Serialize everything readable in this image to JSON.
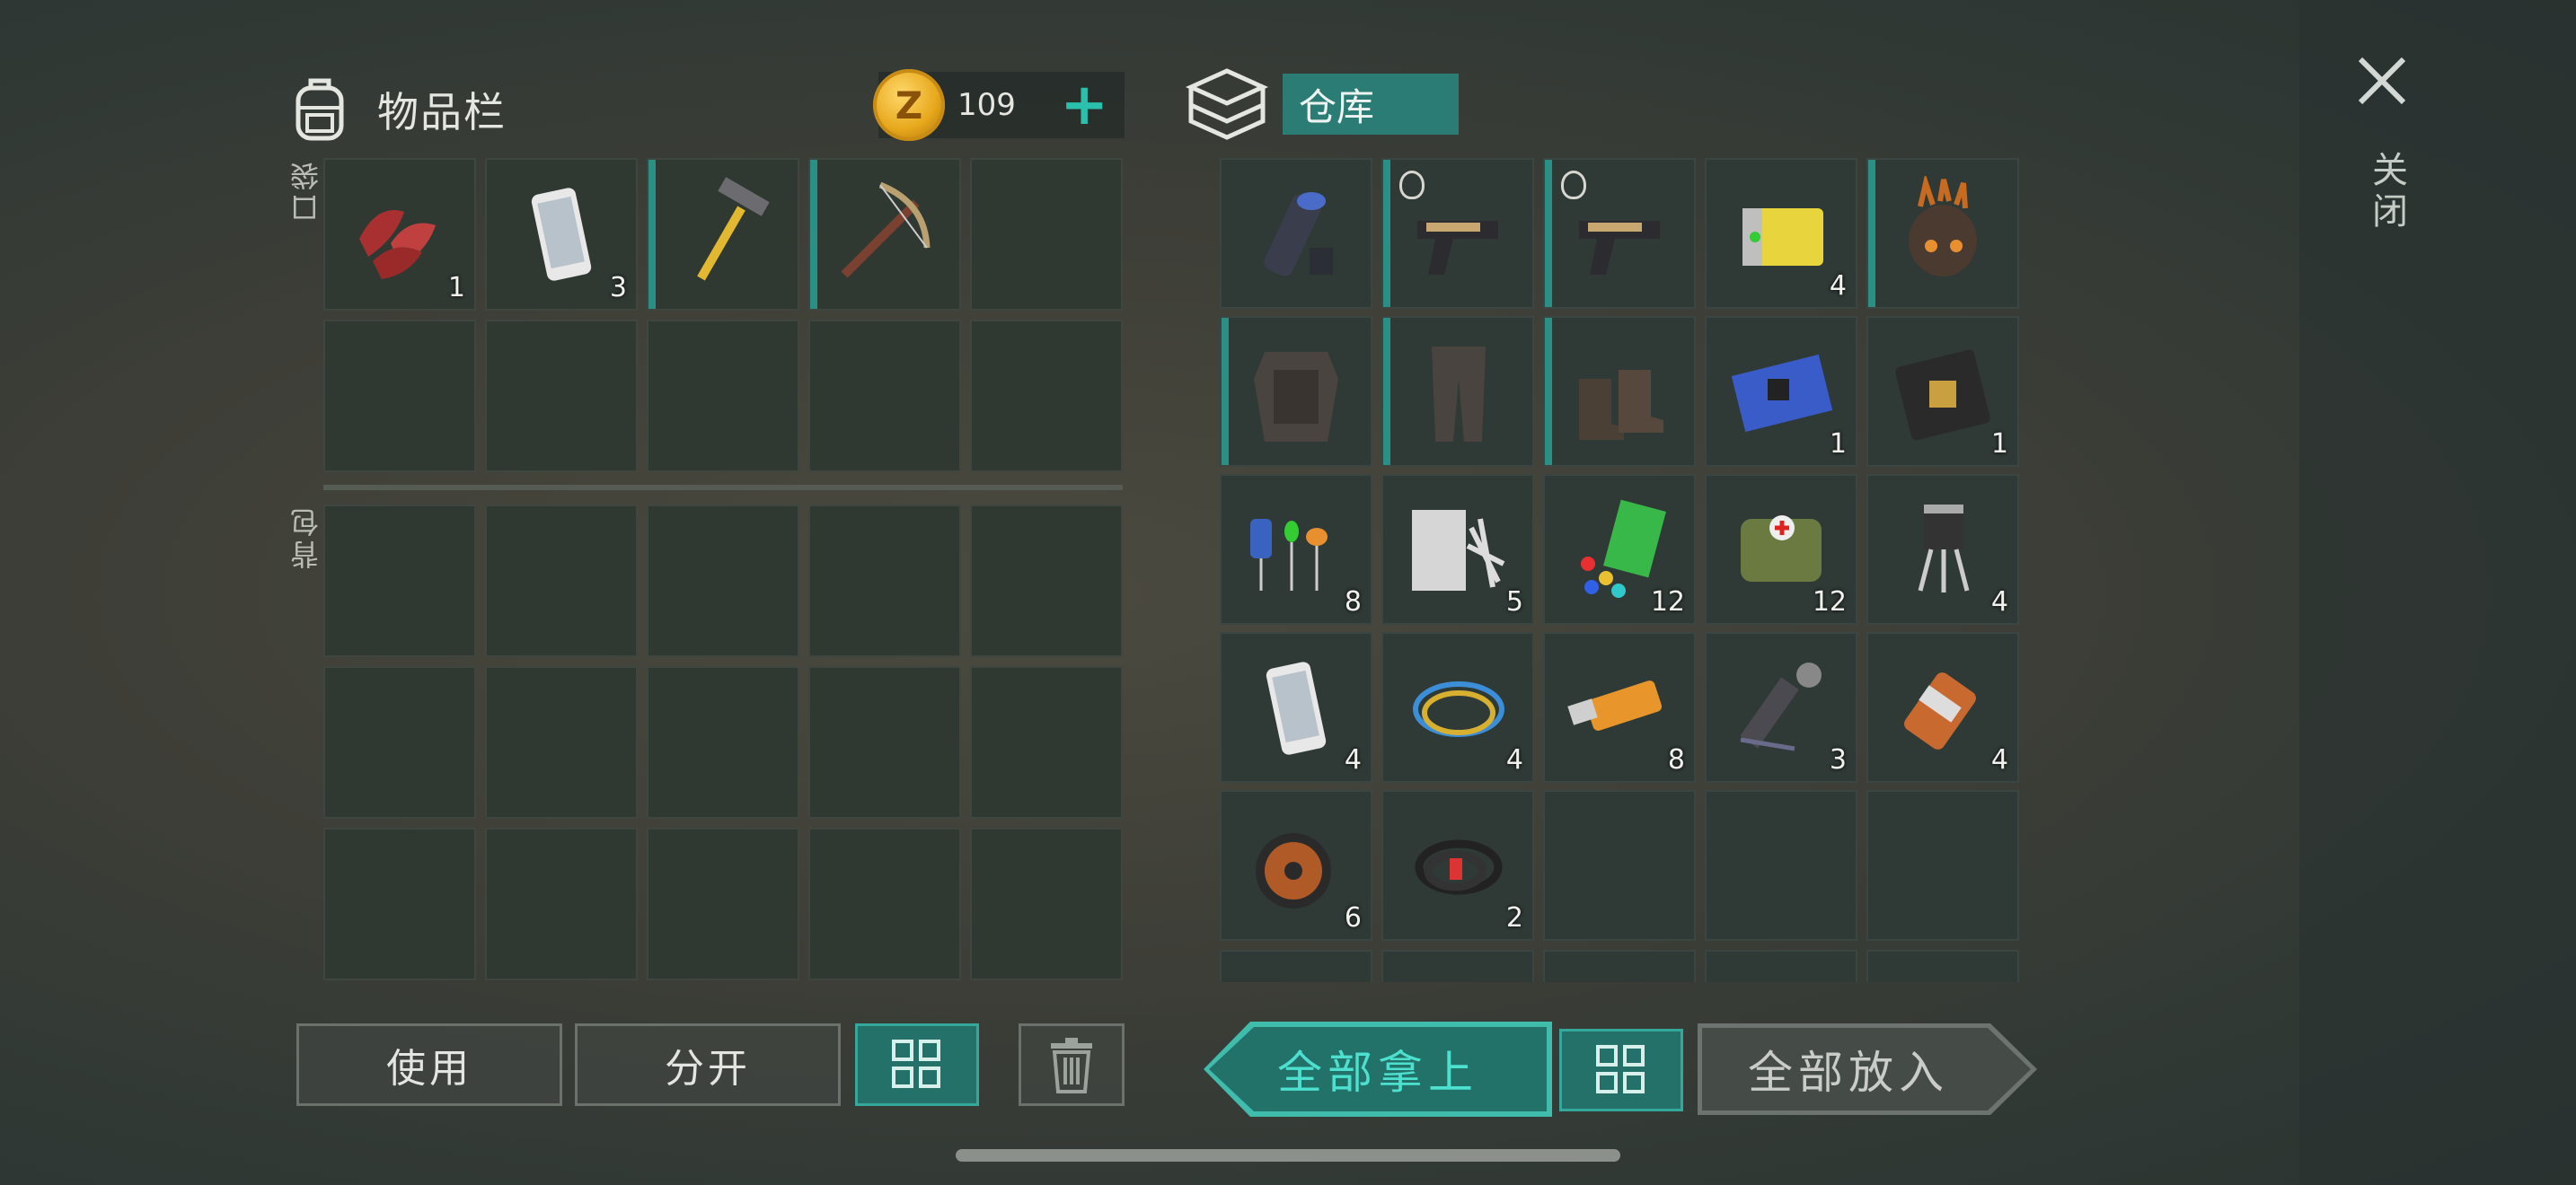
{
  "inventory": {
    "title": "物品栏",
    "coins": "109",
    "coin_symbol": "Z",
    "pocket_label": "口袋",
    "backpack_label": "背包",
    "pocket_slots": [
      {
        "item": "raw-meat",
        "qty": "1",
        "equip": false
      },
      {
        "item": "smartphone",
        "qty": "3",
        "equip": false
      },
      {
        "item": "hammer",
        "qty": "",
        "equip": true
      },
      {
        "item": "crossbow",
        "qty": "",
        "equip": true
      },
      {
        "item": "",
        "qty": "",
        "equip": false
      }
    ]
  },
  "storage": {
    "title": "仓库",
    "slots": [
      {
        "item": "flashlight",
        "qty": "",
        "equip": false,
        "lock": false
      },
      {
        "item": "pistol",
        "qty": "",
        "equip": true,
        "lock": true
      },
      {
        "item": "pistol",
        "qty": "",
        "equip": true,
        "lock": true
      },
      {
        "item": "battery",
        "qty": "4",
        "equip": false,
        "lock": false
      },
      {
        "item": "spiked-helmet",
        "qty": "",
        "equip": true,
        "lock": false
      },
      {
        "item": "armor-vest",
        "qty": "",
        "equip": true,
        "lock": false
      },
      {
        "item": "armor-pants",
        "qty": "",
        "equip": true,
        "lock": false
      },
      {
        "item": "armor-boots",
        "qty": "",
        "equip": true,
        "lock": false
      },
      {
        "item": "circuit-board",
        "qty": "1",
        "equip": false,
        "lock": false
      },
      {
        "item": "controller-board",
        "qty": "1",
        "equip": false,
        "lock": false
      },
      {
        "item": "capacitors",
        "qty": "8",
        "equip": false,
        "lock": false
      },
      {
        "item": "cloth-scraps",
        "qty": "5",
        "equip": false,
        "lock": false
      },
      {
        "item": "plastic-parts",
        "qty": "12",
        "equip": false,
        "lock": false
      },
      {
        "item": "first-aid-bag",
        "qty": "12",
        "equip": false,
        "lock": false
      },
      {
        "item": "transistor",
        "qty": "4",
        "equip": false,
        "lock": false
      },
      {
        "item": "smartphone",
        "qty": "4",
        "equip": false,
        "lock": false
      },
      {
        "item": "wires",
        "qty": "4",
        "equip": false,
        "lock": false
      },
      {
        "item": "usb-drive",
        "qty": "8",
        "equip": false,
        "lock": false
      },
      {
        "item": "motor-tool",
        "qty": "3",
        "equip": false,
        "lock": false
      },
      {
        "item": "electric-motor",
        "qty": "4",
        "equip": false,
        "lock": false
      },
      {
        "item": "copper-coil",
        "qty": "6",
        "equip": false,
        "lock": false
      },
      {
        "item": "cable",
        "qty": "2",
        "equip": false,
        "lock": false
      },
      {
        "item": "",
        "qty": "",
        "equip": false,
        "lock": false
      },
      {
        "item": "",
        "qty": "",
        "equip": false,
        "lock": false
      },
      {
        "item": "",
        "qty": "",
        "equip": false,
        "lock": false
      }
    ]
  },
  "buttons": {
    "use": "使用",
    "split": "分开",
    "take_all": "全部拿上",
    "put_all": "全部放入"
  },
  "close_label": "关闭",
  "icons": {
    "backpack": "backpack-icon",
    "storage": "storage-box-icon",
    "close": "close-icon",
    "sort": "sort-grid-icon",
    "trash": "trash-icon",
    "add": "plus-icon"
  },
  "colors": {
    "accent": "#2a8f84",
    "teal_button": "#22726a",
    "coin": "#e7a81c"
  }
}
